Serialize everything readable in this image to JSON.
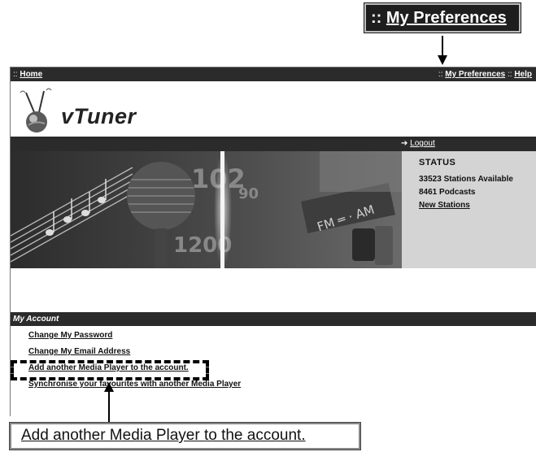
{
  "callouts": {
    "top_prefix": "::",
    "top_label": "My Preferences",
    "bottom_label": "Add another Media Player to the account."
  },
  "topbar": {
    "home_prefix": "::",
    "home": "Home",
    "pref_prefix": "::",
    "preferences": "My Preferences",
    "help_prefix": "::",
    "help": "Help"
  },
  "brand": {
    "name": "vTuner"
  },
  "logoutbar": {
    "arrow": "➔",
    "logout": "Logout"
  },
  "status": {
    "title": "STATUS",
    "stations": "33523  Stations Available",
    "podcasts": "8461  Podcasts",
    "new_stations": "New Stations"
  },
  "account": {
    "title": "My Account",
    "links": [
      "Change My Password",
      "Change My Email Address",
      "Add another Media Player to the account.",
      "Synchronise your favourites with another Media Player"
    ]
  },
  "colors": {
    "dark_bar": "#2b2b2b",
    "status_bg": "#d4d4d4"
  }
}
